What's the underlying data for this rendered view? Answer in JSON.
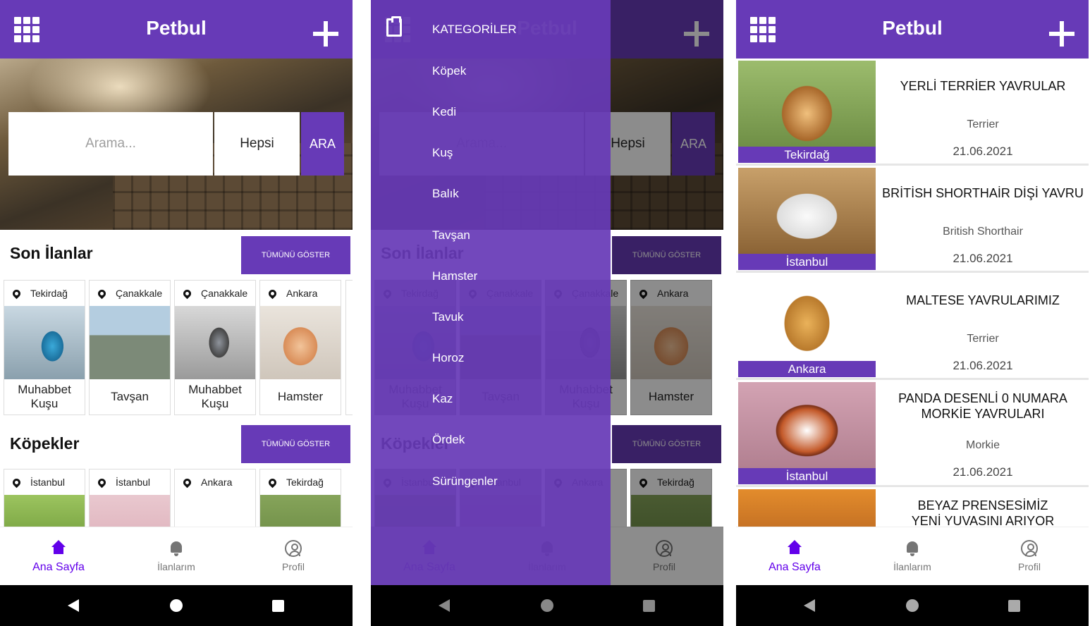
{
  "app": {
    "title": "Petbul",
    "accent_color": "#673ab7"
  },
  "home": {
    "search": {
      "placeholder": "Arama...",
      "filter_value": "Hepsi",
      "button_label": "ARA"
    },
    "sections": [
      {
        "title": "Son İlanlar",
        "show_all_label": "TÜMÜNÜ GÖSTER",
        "cards": [
          {
            "city": "Tekirdağ",
            "label": "Muhabbet Kuşu",
            "image": "budgie"
          },
          {
            "city": "Çanakkale",
            "label": "Tavşan",
            "image": "bicycles"
          },
          {
            "city": "Çanakkale",
            "label": "Muhabbet Kuşu",
            "image": "cockatiel"
          },
          {
            "city": "Ankara",
            "label": "Hamster",
            "image": "hamster"
          }
        ]
      },
      {
        "title": "Köpekler",
        "show_all_label": "TÜMÜNÜ GÖSTER",
        "cards": [
          {
            "city": "İstanbul",
            "label": "",
            "image": "rabbit"
          },
          {
            "city": "İstanbul",
            "label": "",
            "image": "cavalier"
          },
          {
            "city": "Ankara",
            "label": "",
            "image": "golden-retriever"
          },
          {
            "city": "Tekirdağ",
            "label": "",
            "image": "beagle"
          }
        ]
      }
    ]
  },
  "bottom_nav": [
    {
      "label": "Ana Sayfa",
      "icon": "home-icon",
      "active": true
    },
    {
      "label": "İlanlarım",
      "icon": "bell-icon",
      "active": false
    },
    {
      "label": "Profil",
      "icon": "profile-icon",
      "active": false
    }
  ],
  "drawer": {
    "header": "KATEGORİLER",
    "header_icon": "clipboard-icon",
    "categories": [
      "Köpek",
      "Kedi",
      "Kuş",
      "Balık",
      "Tavşan",
      "Hamster",
      "Tavuk",
      "Horoz",
      "Kaz",
      "Ördek",
      "Sürüngenler"
    ]
  },
  "listings": [
    {
      "title": "YERLİ TERRİER YAVRULAR",
      "breed": "Terrier",
      "date": "21.06.2021",
      "city": "Tekirdağ",
      "image": "beagle-puppy"
    },
    {
      "title": "BRİTİSH SHORTHAİR DİŞİ YAVRU",
      "breed": "British Shorthair",
      "date": "21.06.2021",
      "city": "İstanbul",
      "image": "white-cat"
    },
    {
      "title": "MALTESE YAVRULARIMIZ",
      "breed": "Terrier",
      "date": "21.06.2021",
      "city": "Ankara",
      "image": "golden-puppy"
    },
    {
      "title": "PANDA DESENLİ 0 NUMARA MORKİE YAVRULARI",
      "breed": "Morkie",
      "date": "21.06.2021",
      "city": "İstanbul",
      "image": "cavalier-puppy"
    },
    {
      "title": "BEYAZ PRENSESİMİZ YENİ YUVASINI ARIYOR",
      "breed": "",
      "date": "",
      "city": "",
      "image": "kittens"
    }
  ]
}
